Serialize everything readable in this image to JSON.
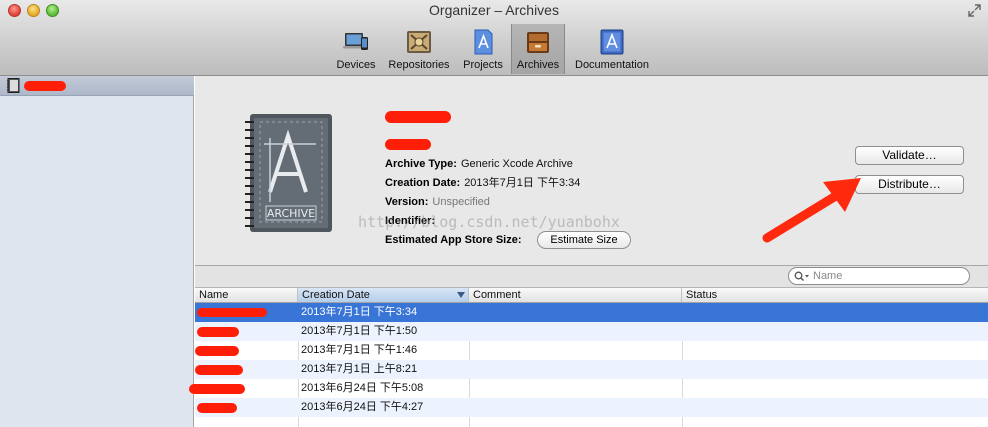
{
  "window": {
    "title": "Organizer – Archives"
  },
  "toolbar": {
    "tabs": [
      {
        "label": "Devices",
        "icon": "devices-icon"
      },
      {
        "label": "Repositories",
        "icon": "repositories-icon"
      },
      {
        "label": "Projects",
        "icon": "projects-icon"
      },
      {
        "label": "Archives",
        "icon": "archives-icon",
        "active": true
      },
      {
        "label": "Documentation",
        "icon": "documentation-icon"
      }
    ]
  },
  "sidebar": {
    "items": [
      {
        "label": "",
        "icon": "project-icon",
        "selected": true
      }
    ]
  },
  "detail": {
    "archive_icon_label": "ARCHIVE",
    "fields": [
      {
        "label": "Archive Type:",
        "value": "Generic Xcode Archive"
      },
      {
        "label": "Creation Date:",
        "value": "2013年7月1日 下午3:34"
      },
      {
        "label": "Version:",
        "value": "Unspecified"
      },
      {
        "label": "Identifier:",
        "value": ""
      },
      {
        "label": "Estimated App Store Size:",
        "value": ""
      }
    ],
    "estimate_button": "Estimate Size",
    "validate_button": "Validate…",
    "distribute_button": "Distribute…",
    "watermark": "http://blog.csdn.net/yuanbohx"
  },
  "search": {
    "placeholder": "Name"
  },
  "table": {
    "columns": [
      "Name",
      "Creation Date",
      "Comment",
      "Status"
    ],
    "sorted_column": "Creation Date",
    "rows": [
      {
        "name": "",
        "date": "2013年7月1日 下午3:34",
        "comment": "",
        "status": "",
        "selected": true
      },
      {
        "name": "",
        "date": "2013年7月1日 下午1:50",
        "comment": "",
        "status": ""
      },
      {
        "name": "",
        "date": "2013年7月1日 下午1:46",
        "comment": "",
        "status": ""
      },
      {
        "name": "",
        "date": "2013年7月1日 上午8:21",
        "comment": "",
        "status": ""
      },
      {
        "name": "",
        "date": "2013年6月24日 下午5:08",
        "comment": "",
        "status": ""
      },
      {
        "name": "",
        "date": "2013年6月24日 下午4:27",
        "comment": "",
        "status": ""
      }
    ]
  },
  "colors": {
    "selection": "#3875d7",
    "annotation_red": "#ff1e08",
    "row_alt": "#edf3fe"
  }
}
